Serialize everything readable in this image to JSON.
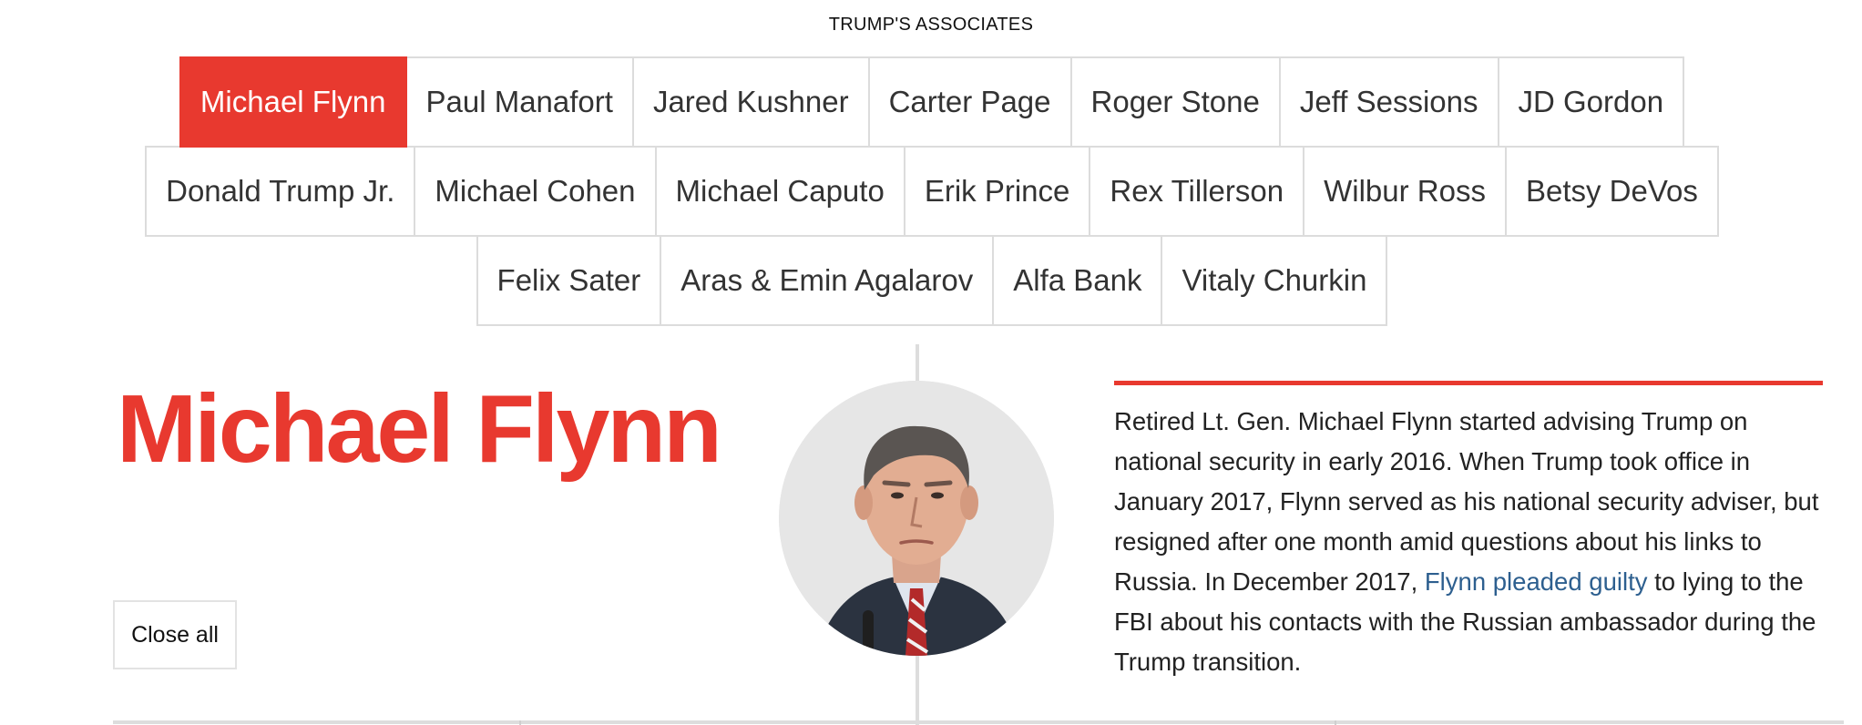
{
  "section_label": "TRUMP'S ASSOCIATES",
  "tabs": {
    "row1": [
      "Michael Flynn",
      "Paul Manafort",
      "Jared Kushner",
      "Carter Page",
      "Roger Stone",
      "Jeff Sessions",
      "JD Gordon"
    ],
    "row2": [
      "Donald Trump Jr.",
      "Michael Cohen",
      "Michael Caputo",
      "Erik Prince",
      "Rex Tillerson",
      "Wilbur Ross",
      "Betsy DeVos"
    ],
    "row3": [
      "Felix Sater",
      "Aras & Emin Agalarov",
      "Alfa Bank",
      "Vitaly Churkin"
    ],
    "active": "Michael Flynn"
  },
  "profile": {
    "name": "Michael Flynn",
    "bio_part1": "Retired Lt. Gen. Michael Flynn started advising Trump on national security in early 2016. When Trump took office in January 2017, Flynn served as his national security adviser, but resigned after one month amid questions about his links to Russia. In December 2017, ",
    "bio_link": "Flynn pleaded guilty",
    "bio_part2": " to lying to the FBI about his contacts with the Russian ambassador during the Trump transition."
  },
  "close_all_label": "Close all",
  "colors": {
    "accent": "#e8392f",
    "link": "#2d5f8f",
    "border": "#dcdcdc"
  }
}
